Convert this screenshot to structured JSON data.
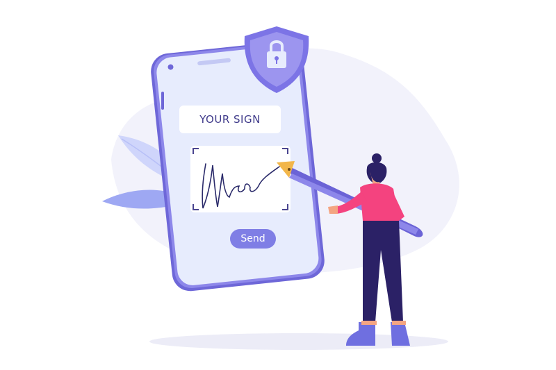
{
  "phone": {
    "title": "YOUR SIGN",
    "send_label": "Send"
  },
  "colors": {
    "accent": "#7f7ee5",
    "shield": "#7c74e6",
    "shirt": "#f4437f",
    "pants": "#2b2166",
    "phone_screen": "#e7ecfd"
  },
  "icons": [
    "lock-icon",
    "camera-icon",
    "pen-icon"
  ]
}
